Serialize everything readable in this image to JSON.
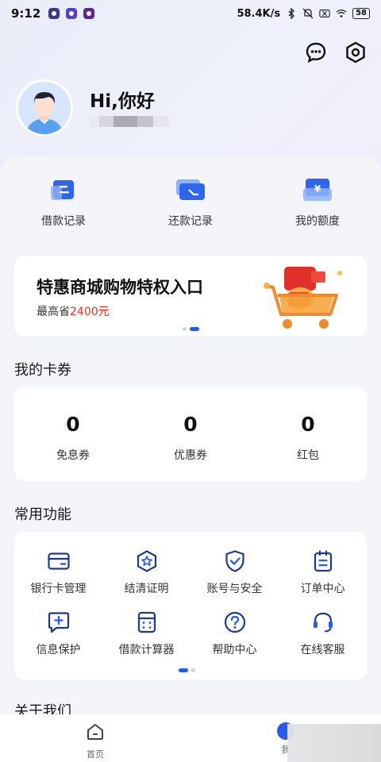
{
  "status_bar": {
    "time": "9:12",
    "speed": "58.4K/s",
    "battery": "58"
  },
  "header": {
    "greeting": "Hi,你好",
    "chat_icon": "chat-bubble-icon",
    "settings_icon": "hexagon-settings-icon"
  },
  "quick_actions": [
    {
      "label": "借款记录",
      "icon": "loan-record-icon"
    },
    {
      "label": "还款记录",
      "icon": "repay-record-icon"
    },
    {
      "label": "我的额度",
      "icon": "credit-limit-icon"
    }
  ],
  "banner": {
    "title": "特惠商城购物特权入口",
    "subtitle_prefix": "最高省",
    "subtitle_amount": "2400元",
    "page_count": 2,
    "active_page": 2
  },
  "coupons": {
    "title": "我的卡券",
    "items": [
      {
        "count": "0",
        "label": "免息券"
      },
      {
        "count": "0",
        "label": "优惠券"
      },
      {
        "count": "0",
        "label": "红包"
      }
    ]
  },
  "functions": {
    "title": "常用功能",
    "items": [
      {
        "label": "银行卡管理",
        "icon": "bank-card-icon"
      },
      {
        "label": "结清证明",
        "icon": "certificate-badge-icon"
      },
      {
        "label": "账号与安全",
        "icon": "shield-check-icon"
      },
      {
        "label": "订单中心",
        "icon": "order-clipboard-icon"
      },
      {
        "label": "信息保护",
        "icon": "message-plus-icon"
      },
      {
        "label": "借款计算器",
        "icon": "calculator-icon"
      },
      {
        "label": "帮助中心",
        "icon": "help-question-icon"
      },
      {
        "label": "在线客服",
        "icon": "headset-icon"
      }
    ],
    "page_count": 2,
    "active_page": 1
  },
  "about": {
    "title": "关于我们"
  },
  "tabbar": {
    "home_label": "首页",
    "me_label": "我"
  },
  "colors": {
    "accent": "#2a5ae8",
    "highlight": "#e0301e"
  }
}
